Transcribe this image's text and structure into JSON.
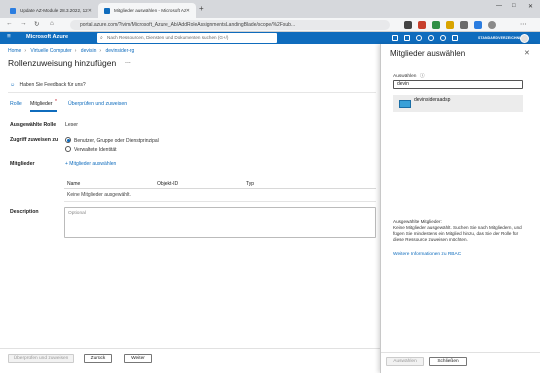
{
  "browser": {
    "tabs": [
      {
        "label": "Update AZ-Module 28.3.2022, 12:37 - 1...",
        "active": false
      },
      {
        "label": "Mitglieder auswählen - Microsoft Az...",
        "active": true
      }
    ],
    "new_tab_glyph": "+",
    "window_controls": [
      "—",
      "□",
      "✕"
    ],
    "url": "portal.azure.com/?ivim/Microsoft_Azure_Ab/AddRoleAssignmentsLandingBlade/scope/%2Fsub..."
  },
  "azure": {
    "brand": "Microsoft Azure",
    "search_placeholder": "Nach Ressourcen, Diensten und Dokumenten suchen (G+/)",
    "user_label": "STANDARDVERZEICHNIS",
    "header_color": "#0f6cbd"
  },
  "breadcrumb": [
    "Home",
    "Virtuelle Computer",
    "devisin",
    "devinsider-rg"
  ],
  "page": {
    "title": "Rollenzuweisung hinzufügen",
    "more": "...",
    "feedback": "Haben Sie Feedback für uns?",
    "tabs": [
      "Rolle",
      "Mitglieder",
      "Überprüfen und zuweisen"
    ],
    "required_marker": "*",
    "selected_role_label": "Ausgewählte Rolle",
    "selected_role_value": "Leser",
    "access_label": "Zugriff zuweisen zu",
    "access_options": [
      "Benutzer, Gruppe oder Dienstprinzipal",
      "Verwaltete Identität"
    ],
    "members_label": "Mitglieder",
    "add_members": "+ Mitglieder auswählen",
    "table_headers": [
      "Name",
      "Objekt-ID",
      "Typ"
    ],
    "table_empty": "Keine Mitglieder ausgewählt.",
    "description_label": "Description",
    "description_placeholder": "Optional",
    "buttons": {
      "review": "Überprüfen und zuweisen",
      "back": "Zurück",
      "next": "Weiter"
    }
  },
  "panel": {
    "title": "Mitglieder auswählen",
    "select_label": "Auswählen",
    "search_value": "devin",
    "result_name": "devinsideraadsp",
    "info_heading": "Ausgewählte Mitglieder:",
    "info_text": "Keine Mitglieder ausgewählt. Suchen Sie nach Mitgliedern, und fügen Sie mindestens ein Mitglied hinzu, das Sie der Rolle für diese Ressource zuweisen möchten.",
    "learn_more": "Weitere Informationen zu RBAC",
    "buttons": {
      "select": "Auswählen",
      "close": "Schließen"
    }
  }
}
